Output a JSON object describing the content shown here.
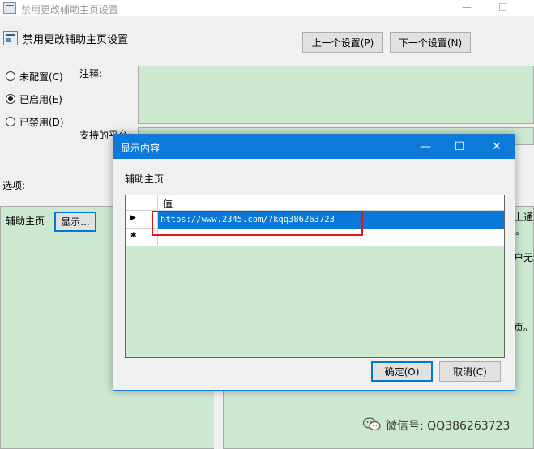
{
  "window": {
    "title": "禁用更改辅助主页设置",
    "heading": "禁用更改辅助主页设置",
    "minimize_glyph": "—",
    "maximize_glyph": "☐"
  },
  "nav": {
    "prev_label": "上一个设置(P)",
    "next_label": "下一个设置(N)"
  },
  "state_options": [
    {
      "label": "未配置(C)",
      "checked": false
    },
    {
      "label": "已启用(E)",
      "checked": true
    },
    {
      "label": "已禁用(D)",
      "checked": false
    }
  ],
  "labels": {
    "comment": "注释:",
    "supported": "支持的平台:",
    "options": "选项:"
  },
  "options_panel": {
    "field_label": "辅助主页",
    "show_button": "显示..."
  },
  "help_fragments": [
    "上通",
    "。",
    "户无",
    "页。"
  ],
  "dialog": {
    "title": "显示内容",
    "section_label": "辅助主页",
    "column_header": "值",
    "rows": [
      {
        "marker": "▶",
        "value": "https://www.2345.com/?kqq386263723"
      }
    ],
    "new_row_marker": "✱",
    "ok_label": "确定(O)",
    "cancel_label": "取消(C)",
    "minimize_glyph": "—",
    "maximize_glyph": "☐",
    "close_glyph": "✕"
  },
  "watermark": {
    "text": "微信号: QQ386263723"
  },
  "colors": {
    "accent": "#0078d7",
    "editor_green": "#cce8cf",
    "highlight_box": "#e01616"
  }
}
